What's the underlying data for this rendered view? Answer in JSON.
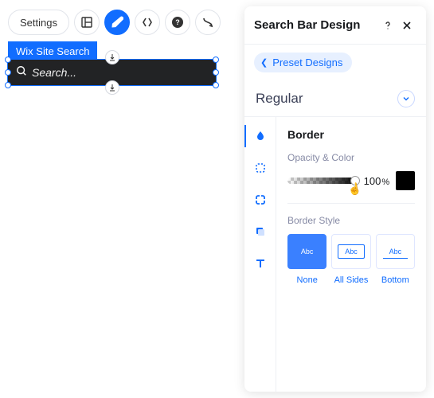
{
  "toolbar": {
    "settings_label": "Settings"
  },
  "component": {
    "tag": "Wix Site Search",
    "placeholder": "Search..."
  },
  "panel": {
    "title": "Search Bar Design",
    "back_label": "Preset Designs",
    "state_label": "Regular",
    "section_title": "Border",
    "opacity_label": "Opacity & Color",
    "opacity_value": "100",
    "opacity_unit": "%",
    "swatch_color": "#000000",
    "border_style_label": "Border Style",
    "styles": {
      "sample_text": "Abc",
      "labels": [
        "None",
        "All Sides",
        "Bottom"
      ]
    }
  }
}
